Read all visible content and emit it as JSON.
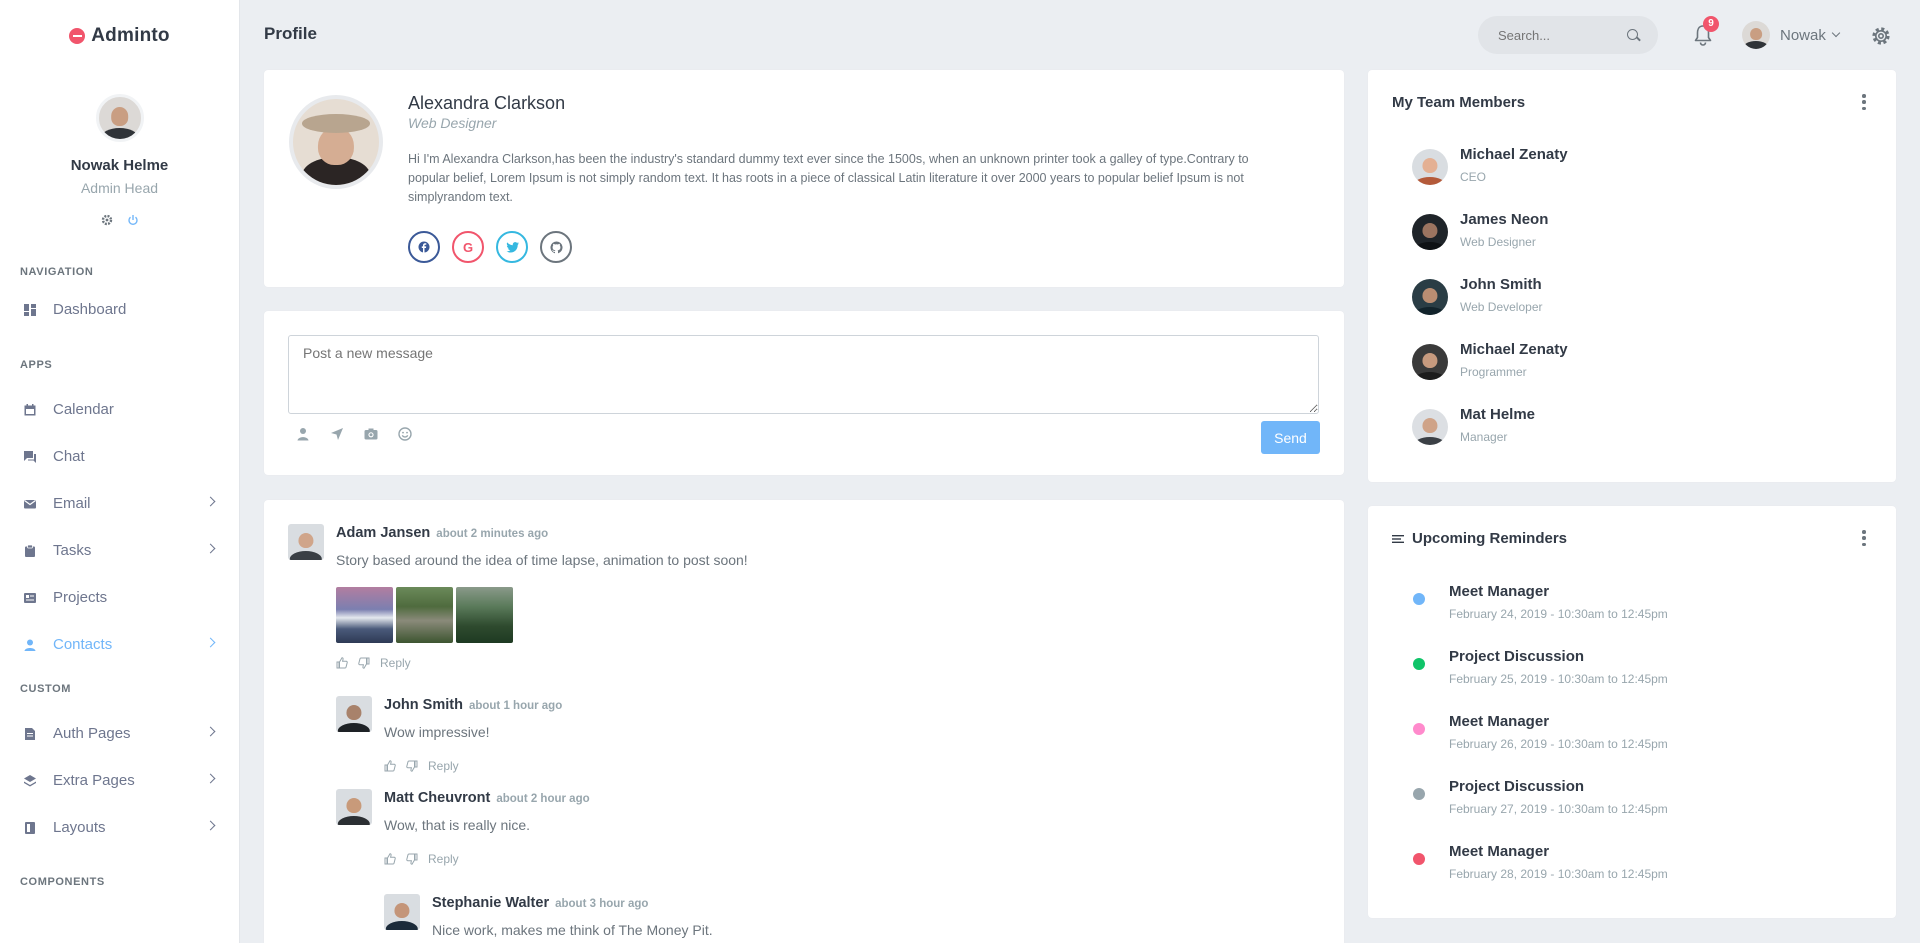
{
  "brand": {
    "name": "Adminto"
  },
  "sidebar": {
    "user": {
      "name": "Nowak Helme",
      "role": "Admin Head"
    },
    "sections": [
      {
        "title": "Navigation"
      },
      {
        "title": "Apps"
      },
      {
        "title": "Custom"
      },
      {
        "title": "Components"
      }
    ],
    "items": [
      {
        "label": "Dashboard",
        "icon": "dashboard-icon"
      },
      {
        "label": "Calendar",
        "icon": "calendar-icon"
      },
      {
        "label": "Chat",
        "icon": "chat-icon"
      },
      {
        "label": "Email",
        "icon": "email-icon"
      },
      {
        "label": "Tasks",
        "icon": "clipboard-icon"
      },
      {
        "label": "Projects",
        "icon": "projects-icon"
      },
      {
        "label": "Contacts",
        "icon": "contacts-icon",
        "active": true
      },
      {
        "label": "Auth Pages",
        "icon": "file-icon"
      },
      {
        "label": "Extra Pages",
        "icon": "layers-icon"
      },
      {
        "label": "Layouts",
        "icon": "layout-icon"
      }
    ]
  },
  "topbar": {
    "title": "Profile",
    "search_placeholder": "Search...",
    "notification_count": "9",
    "user_name": "Nowak"
  },
  "profile": {
    "name": "Alexandra Clarkson",
    "title": "Web Designer",
    "bio": "Hi I'm Alexandra Clarkson,has been the industry's standard dummy text ever since the 1500s, when an unknown printer took a galley of type.Contrary to popular belief, Lorem Ipsum is not simply random text. It has roots in a piece of classical Latin literature it over 2000 years to popular belief Ipsum is not simplyrandom text.",
    "socials": [
      {
        "name": "facebook-icon",
        "glyph": "f",
        "color": "#3b5998"
      },
      {
        "name": "google-icon",
        "glyph": "G",
        "color": "#f1556c"
      },
      {
        "name": "twitter-icon",
        "glyph": "t",
        "color": "#35b8e0"
      },
      {
        "name": "github-icon",
        "glyph": "⌥",
        "color": "#6c757d"
      }
    ]
  },
  "composer": {
    "placeholder": "Post a new message",
    "send_label": "Send"
  },
  "comments": [
    {
      "name": "Adam Jansen",
      "time": "about 2 minutes ago",
      "text": "Story based around the idea of time lapse, animation to post soon!",
      "reply": "Reply"
    },
    {
      "name": "John Smith",
      "time": "about 1 hour ago",
      "text": "Wow impressive!",
      "reply": "Reply"
    },
    {
      "name": "Matt Cheuvront",
      "time": "about 2 hour ago",
      "text": "Wow, that is really nice.",
      "reply": "Reply"
    },
    {
      "name": "Stephanie Walter",
      "time": "about 3 hour ago",
      "text": "Nice work, makes me think of The Money Pit."
    }
  ],
  "team": {
    "title": "My Team Members",
    "members": [
      {
        "name": "Michael Zenaty",
        "role": "CEO"
      },
      {
        "name": "James Neon",
        "role": "Web Designer"
      },
      {
        "name": "John Smith",
        "role": "Web Developer"
      },
      {
        "name": "Michael Zenaty",
        "role": "Programmer"
      },
      {
        "name": "Mat Helme",
        "role": "Manager"
      }
    ]
  },
  "reminders": {
    "title": "Upcoming Reminders",
    "items": [
      {
        "title": "Meet Manager",
        "date": "February 24, 2019 - 10:30am to 12:45pm",
        "color": "#71b6f9"
      },
      {
        "title": "Project Discussion",
        "date": "February 25, 2019 - 10:30am to 12:45pm",
        "color": "#10c469"
      },
      {
        "title": "Meet Manager",
        "date": "February 26, 2019 - 10:30am to 12:45pm",
        "color": "#ff8acc"
      },
      {
        "title": "Project Discussion",
        "date": "February 27, 2019 - 10:30am to 12:45pm",
        "color": "#98a6ad"
      },
      {
        "title": "Meet Manager",
        "date": "February 28, 2019 - 10:30am to 12:45pm",
        "color": "#f1556c"
      }
    ]
  }
}
